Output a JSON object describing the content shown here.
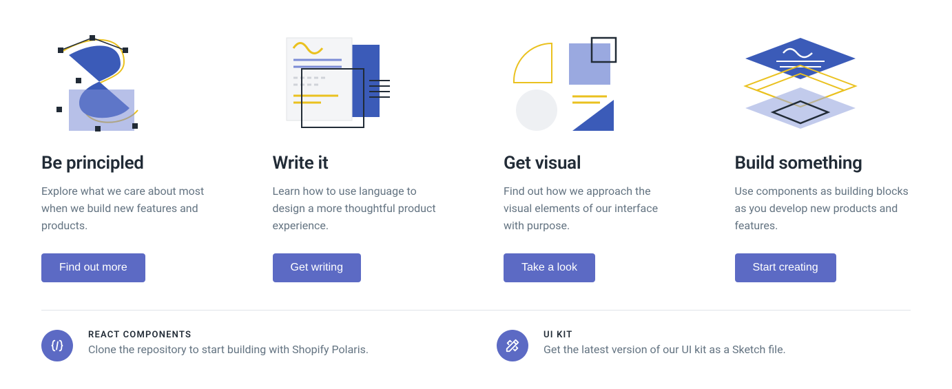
{
  "cards": [
    {
      "title": "Be principled",
      "desc": "Explore what we care about most when we build new features and products.",
      "cta": "Find out more"
    },
    {
      "title": "Write it",
      "desc": "Learn how to use language to design a more thoughtful product experience.",
      "cta": "Get writing"
    },
    {
      "title": "Get visual",
      "desc": "Find out how we approach the visual elements of our interface with purpose.",
      "cta": "Take a look"
    },
    {
      "title": "Build something",
      "desc": "Use components as building blocks as you develop new products and features.",
      "cta": "Start creating"
    }
  ],
  "resources": [
    {
      "label": "REACT COMPONENTS",
      "desc": "Clone the repository to start building with Shopify Polaris."
    },
    {
      "label": "UI KIT",
      "desc": "Get the latest version of our UI kit as a Sketch file."
    }
  ]
}
